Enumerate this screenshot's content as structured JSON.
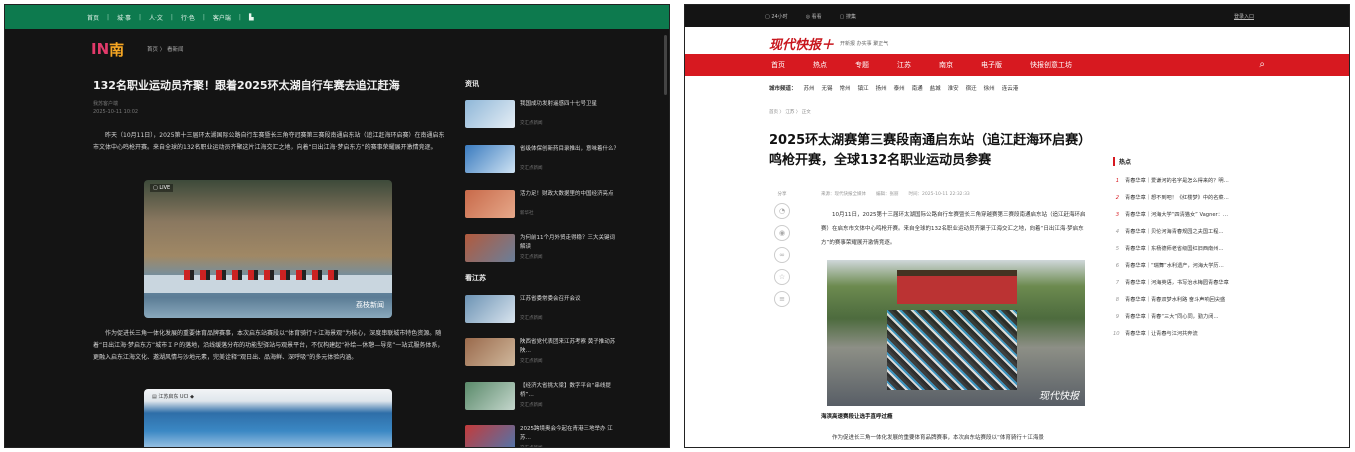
{
  "left": {
    "topbar": [
      "首页",
      "城·事",
      "人·文",
      "行·色",
      "客户端",
      "▙"
    ],
    "logo_text": "IN",
    "logo_char": "南",
    "breadcrumb": "首页 〉 看新闻",
    "title": "132名职业运动员齐聚！跟着2025环太湖自行车赛去追江赶海",
    "source": "我苏客户端",
    "date": "2025-10-11 10:02",
    "para1": "昨天（10月11日），2025第十三届环太湖国际公路自行车赛暨长三角夺冠赛第三赛段南通启东站（追江赶海环启赛）在南通启东市文体中心鸣枪开赛。来自全球的132名职业运动员齐聚这片江海交汇之地，向着“日出江海·梦启东方”的赛事荣耀展开激情竞逐。",
    "photo1_badge": "▢ LIVE",
    "photo1_watermark": "荔枝新闻",
    "para2": "作为促进长三角一体化发展的重要体育品牌赛事，本次启东站赛段以“体育骑行＋江海景观”为核心，深度串联城市特色资源。随着“日出江海·梦启东方”城市ＩＰ的落地，沿线缓落分布的功能型驿站与观景平台，不仅构建起“补给—休憩—导览”一站式服务体系，更融入启东江海文化、邀湖风情与沙地元素，完美诠释“观日出、品海鲜、深呼吸”的多元体验内涵。",
    "photo2_logos": "▤ 江苏启东  UCI ◆",
    "section_news": "资讯",
    "news": [
      {
        "title": "我国成功发射遥感四十七号卫星",
        "src": "交汇点新闻"
      },
      {
        "title": "省级体保创新药目录推出，意味着什么？",
        "src": "交汇点新闻"
      },
      {
        "title": "活力足！财政大数据里的中国经济亮点",
        "src": "新华社"
      },
      {
        "title": "为何前11个月外贸走得稳？三大关键词解读",
        "src": "交汇点新闻"
      }
    ],
    "section_js": "看江苏",
    "js_news": [
      {
        "title": "江苏省委常委会召开会议",
        "src": "交汇点新闻"
      },
      {
        "title": "陕西省党代表团来江苏考察 黄子推动苏陕…",
        "src": "交汇点新闻"
      },
      {
        "title": "【经济大省挑大梁】数字平台“串线提桥”…",
        "src": "交汇点新闻"
      },
      {
        "title": "2025跨境奥会今起在青港三地举办 江苏…",
        "src": "交汇点新闻"
      }
    ]
  },
  "right": {
    "topstrip": [
      "▢ 24小时",
      "◎ 看看",
      "▢ 搜集"
    ],
    "login": "登录入口",
    "brand": "现代快报＋",
    "tagline": "开新报  办实事  聚正气",
    "nav": [
      "首页",
      "热点",
      "专题",
      "江苏",
      "南京",
      "电子版",
      "快报创意工坊"
    ],
    "cities_label": "城市频道：",
    "cities": [
      "苏州",
      "无锡",
      "常州",
      "镇江",
      "扬州",
      "泰州",
      "南通",
      "盐城",
      "淮安",
      "宿迁",
      "徐州",
      "连云港"
    ],
    "breadcrumb": "首页 〉 江苏 〉 正文",
    "title": "2025环太湖赛第三赛段南通启东站（追江赶海环启赛）鸣枪开赛，全球132名职业运动员参赛",
    "share_label": "分享",
    "meta": [
      "来源：现代快报全媒体",
      "编辑：张丽",
      "时间：2025-10-11 22:32:33"
    ],
    "body1": "10月11日，2025第十三届环太湖国际公路自行车赛暨长三角穿越赛第三赛段南通启东站（追江赶海环启赛）在启东市文体中心鸣枪开赛。来自全球的132名职业运动员齐聚于江海交汇之地，向着“日出江海·梦启东方”的赛事荣耀展开激情竞逐。",
    "photo_watermark": "现代快报",
    "caption": "海滨高速赛段让选手直呼过瘾",
    "body2": "作为促进长三角一体化发展的重要体育品牌赛事，本次启东站赛段以“体育骑行＋江海景",
    "hot_heading": "热点",
    "hot": [
      "青春华章｜爱谦河的名字是怎么得来的？明…",
      "青春华章｜想不到吧！《红楼梦》中的名菜…",
      "青春华章｜河海大学“四清猫女” Vagner：…",
      "青春华章｜贝伦河海青春规园之夫国工程…",
      "青春华章｜东杨德师老省级国红旧西南州…",
      "青春华章｜“瑞舞”水利遗产，河海大学历…",
      "青春华章｜河海英语，书写治水梅园青春华章",
      "青春华章｜青春双梦水利路 奋斗声响回尖盛",
      "青春华章｜青春“三大”同心同，勤力闭…",
      "青春华章｜让青春与江河共奔流"
    ],
    "colors": {
      "nav": "#d71920",
      "brand": "#c8161d"
    }
  }
}
